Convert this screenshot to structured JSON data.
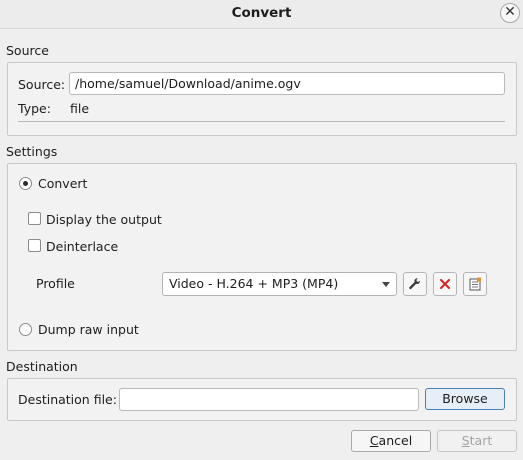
{
  "window": {
    "title": "Convert",
    "close_icon": "close-icon"
  },
  "source": {
    "section_label": "Source",
    "source_label": "Source:",
    "source_value": "/home/samuel/Download/anime.ogv",
    "type_label": "Type:",
    "type_value": "file"
  },
  "settings": {
    "section_label": "Settings",
    "convert_label": "Convert",
    "convert_selected": true,
    "display_output_label": "Display the output",
    "display_output_checked": false,
    "deinterlace_label": "Deinterlace",
    "deinterlace_checked": false,
    "profile_label": "Profile",
    "profile_value": "Video - H.264 + MP3 (MP4)",
    "profile_tools": [
      "wrench-icon",
      "delete-icon",
      "new-profile-icon"
    ],
    "dump_raw_label": "Dump raw input",
    "dump_raw_selected": false
  },
  "destination": {
    "section_label": "Destination",
    "file_label": "Destination file:",
    "file_value": "",
    "browse_label": "Browse"
  },
  "buttons": {
    "cancel_label": "Cancel",
    "start_label": "Start"
  },
  "colors": {
    "delete_red": "#d22b2b",
    "focus_blue": "#4a7fb8"
  }
}
